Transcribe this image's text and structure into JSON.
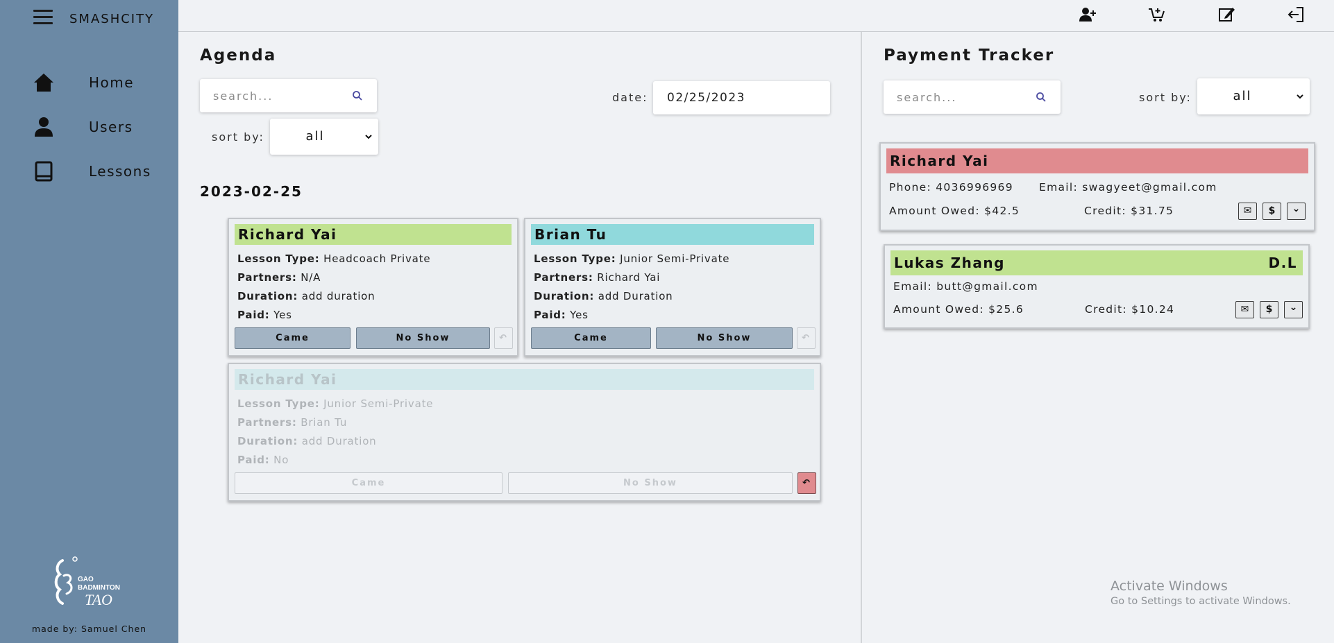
{
  "app": {
    "brand": "SMASHCITY",
    "credit": "made by: Samuel Chen",
    "logo_text": "GAO BADMINTON TAO"
  },
  "nav": [
    {
      "label": "Home",
      "icon": "home-icon"
    },
    {
      "label": "Users",
      "icon": "user-icon"
    },
    {
      "label": "Lessons",
      "icon": "book-icon"
    }
  ],
  "topbar": {
    "icons": [
      "add-user-icon",
      "cart-add-icon",
      "edit-icon",
      "logout-icon"
    ]
  },
  "agenda": {
    "title": "Agenda",
    "search_placeholder": "search...",
    "date_label": "date:",
    "date_value": "02/25/2023",
    "sort_label": "sort by:",
    "sort_value": "all",
    "date_heading": "2023-02-25",
    "lesson_type_label": "Lesson Type:",
    "partners_label": "Partners:",
    "duration_label": "Duration:",
    "paid_label": "Paid:",
    "came_label": "Came",
    "noshow_label": "No Show",
    "undo_glyph": "↶",
    "lessons": [
      {
        "name": "Richard Yai",
        "lesson_type": "Headcoach Private",
        "partners": "N/A",
        "duration": "add duration",
        "paid": "Yes",
        "header_color": "#c0e290"
      },
      {
        "name": "Brian Tu",
        "lesson_type": "Junior Semi-Private",
        "partners": "Richard Yai",
        "duration": "add Duration",
        "paid": "Yes",
        "header_color": "#90d9dc"
      },
      {
        "name": "Richard Yai",
        "lesson_type": "Junior Semi-Private",
        "partners": "Brian Tu",
        "duration": "add Duration",
        "paid": "No",
        "header_color": "#d4e9ec"
      }
    ]
  },
  "payment": {
    "title": "Payment Tracker",
    "search_placeholder": "search...",
    "sort_label": "sort by:",
    "sort_value": "all",
    "mail_glyph": "✉",
    "dollar_glyph": "$",
    "expand_glyph": "⌄",
    "cards": [
      {
        "name": "Richard Yai",
        "badge": "",
        "phone": "Phone: 4036996969",
        "email": "Email: swagyeet@gmail.com",
        "owed": "Amount Owed: $42.5",
        "credit": "Credit: $31.75",
        "header_color": "#e08b8f"
      },
      {
        "name": "Lukas Zhang",
        "badge": "D.L",
        "phone": "",
        "email": "Email: butt@gmail.com",
        "owed": "Amount Owed: $25.6",
        "credit": "Credit: $10.24",
        "header_color": "#c0e290"
      }
    ]
  },
  "watermark": {
    "line1": "Activate Windows",
    "line2": "Go to Settings to activate Windows."
  }
}
